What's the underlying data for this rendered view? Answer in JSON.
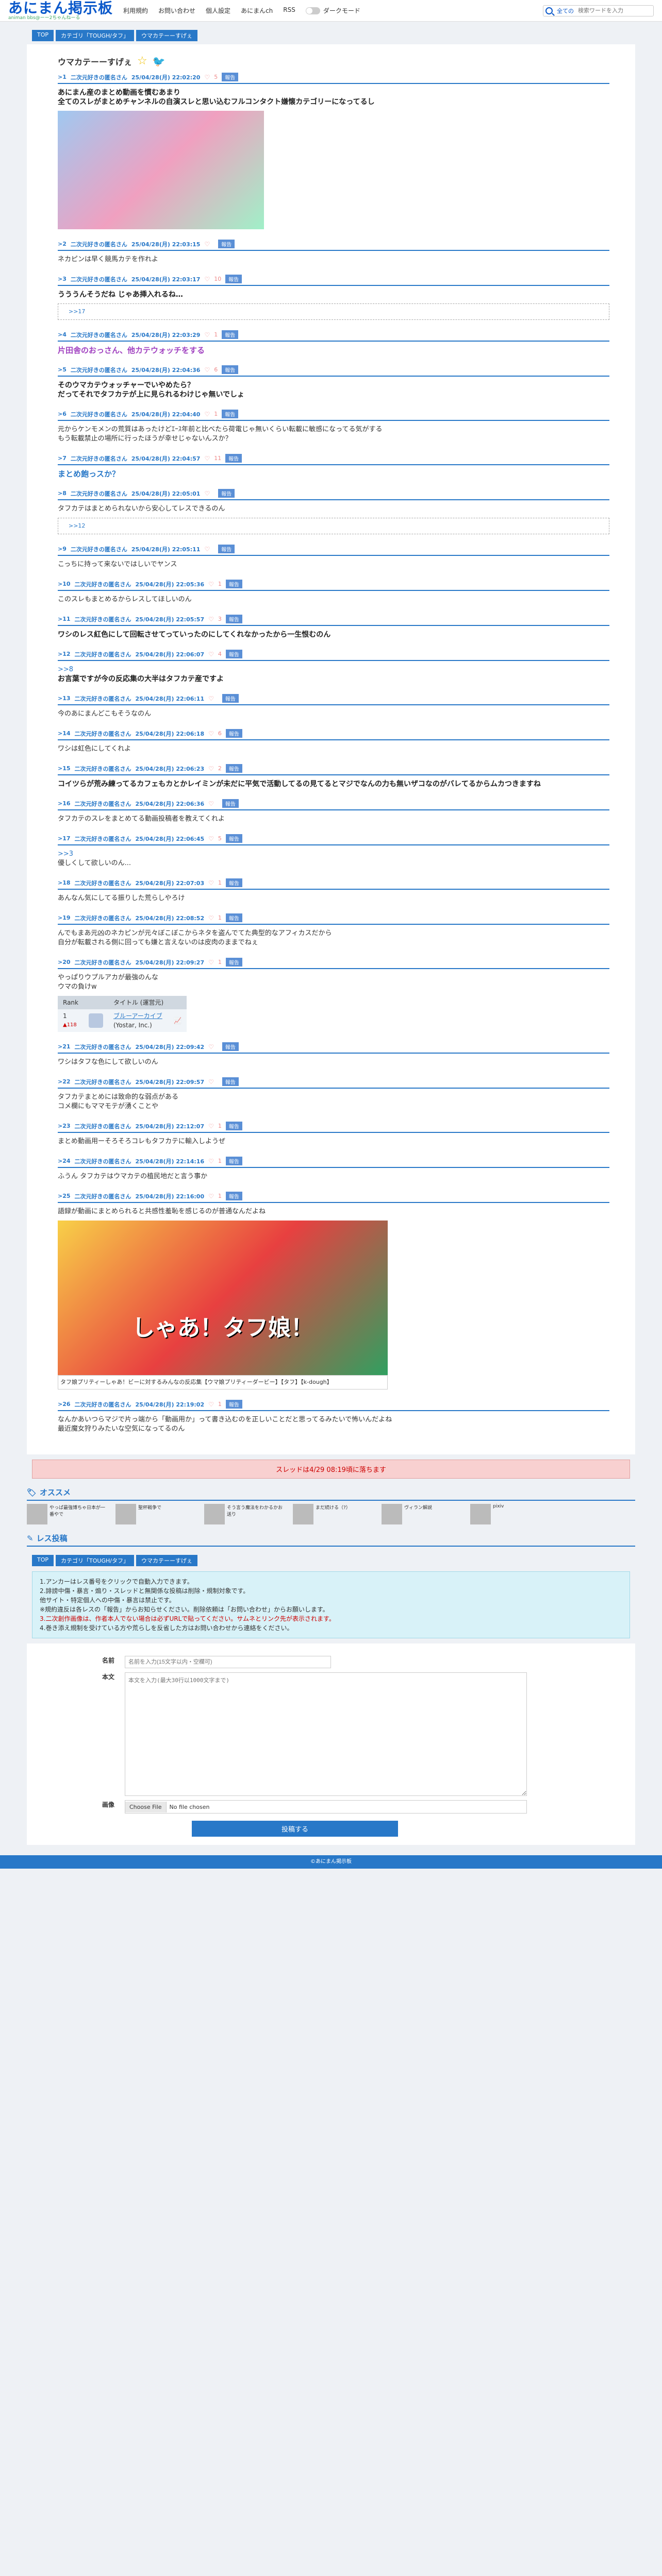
{
  "header": {
    "logo": "あにまん掲示板",
    "logo_sub": "animan bbs@ーー2ちゃんねーる",
    "nav": [
      "利用規約",
      "お問い合わせ",
      "個人設定",
      "あにまんch",
      "RSS"
    ],
    "dark_mode": "ダークモード",
    "search_select": "全ての",
    "search_placeholder": "検索ワードを入力"
  },
  "breadcrumb": [
    "TOP",
    "カテゴリ「TOUGH/タフ」",
    "ウマカテーーすげぇ"
  ],
  "thread_title": "ウマカテーーすげぇ",
  "posts": [
    {
      "num": ">1",
      "name": "二次元好きの匿名さん",
      "date": "25/04/28(月) 22:02:20",
      "likes": "5",
      "report": "報告",
      "body": [
        "あにまん産のまとめ動画を慣むあまり",
        "全てのスレがまとめチャンネルの自演スレと思い込むフルコンタクト嫌懐カテゴリーになってるし"
      ]
    },
    {
      "num": ">2",
      "name": "二次元好きの匿名さん",
      "date": "25/04/28(月) 22:03:15",
      "likes": "",
      "report": "報告",
      "body": [
        "ネカピンは早く競馬カテを作れよ"
      ]
    },
    {
      "num": ">3",
      "name": "二次元好きの匿名さん",
      "date": "25/04/28(月) 22:03:17",
      "likes": "10",
      "report": "報告",
      "body": [
        "うううんそうだね じゃあ挿入れるね…"
      ],
      "ref": ">>17"
    },
    {
      "num": ">4",
      "name": "二次元好きの匿名さん",
      "date": "25/04/28(月) 22:03:29",
      "likes": "1",
      "report": "報告",
      "body": [
        "片田舎のおっさん、他カテウォッチをする"
      ]
    },
    {
      "num": ">5",
      "name": "二次元好きの匿名さん",
      "date": "25/04/28(月) 22:04:36",
      "likes": "6",
      "report": "報告",
      "body": [
        "そのウマカテウォッチャーでいやめたら？",
        "だってそれでタフカテが上に見られるわけじゃ無いでしょ"
      ]
    },
    {
      "num": ">6",
      "name": "二次元好きの匿名さん",
      "date": "25/04/28(月) 22:04:40",
      "likes": "1",
      "report": "報告",
      "body": [
        "元からケンモメンの荒質はあったけどｴｰｽ年前と比べたら荷電じゃ無いくらい転載に敏感になってる気がする",
        "もう転載禁止の場所に行ったほうが幸せじゃないんスか？"
      ]
    },
    {
      "num": ">7",
      "name": "二次元好きの匿名さん",
      "date": "25/04/28(月) 22:04:57",
      "likes": "11",
      "report": "報告",
      "body": [
        "まとめ飽っスか？"
      ]
    },
    {
      "num": ">8",
      "name": "二次元好きの匿名さん",
      "date": "25/04/28(月) 22:05:01",
      "likes": "",
      "report": "報告",
      "body": [
        "タフカテはまとめられないから安心してレスできるのん"
      ],
      "ref": ">>12"
    },
    {
      "num": ">9",
      "name": "二次元好きの匿名さん",
      "date": "25/04/28(月) 22:05:11",
      "likes": "",
      "report": "報告",
      "body": [
        "こっちに持って来ないではしいでヤンス"
      ]
    },
    {
      "num": ">10",
      "name": "二次元好きの匿名さん",
      "date": "25/04/28(月) 22:05:36",
      "likes": "1",
      "report": "報告",
      "body": [
        "このスレもまとめるからレスしてほしいのん"
      ]
    },
    {
      "num": ">11",
      "name": "二次元好きの匿名さん",
      "date": "25/04/28(月) 22:05:57",
      "likes": "3",
      "report": "報告",
      "body": [
        "ワシのレス紅色にして回転させてっていったのにしてくれなかったから一生恨むのん"
      ]
    },
    {
      "num": ">12",
      "name": "二次元好きの匿名さん",
      "date": "25/04/28(月) 22:06:07",
      "likes": "4",
      "report": "報告",
      "anc": ">>8",
      "body": [
        "お言葉ですが今の反応集の大半はタフカテ産ですよ"
      ]
    },
    {
      "num": ">13",
      "name": "二次元好きの匿名さん",
      "date": "25/04/28(月) 22:06:11",
      "likes": "",
      "report": "報告",
      "body": [
        "今のあにまんどこもそうなのん"
      ]
    },
    {
      "num": ">14",
      "name": "二次元好きの匿名さん",
      "date": "25/04/28(月) 22:06:18",
      "likes": "6",
      "report": "報告",
      "body": [
        "ワシは虹色にしてくれよ"
      ]
    },
    {
      "num": ">15",
      "name": "二次元好きの匿名さん",
      "date": "25/04/28(月) 22:06:23",
      "likes": "2",
      "report": "報告",
      "body": [
        "コイツらが荒み練ってるカフェもカとかレイミンが未だに平気で活動してるの見てるとマジでなんの力も無いザコなのがバレてるからムカつきますね"
      ]
    },
    {
      "num": ">16",
      "name": "二次元好きの匿名さん",
      "date": "25/04/28(月) 22:06:36",
      "likes": "",
      "report": "報告",
      "body": [
        "タフカテのスレをまとめてる動画投稿者を教えてくれよ"
      ]
    },
    {
      "num": ">17",
      "name": "二次元好きの匿名さん",
      "date": "25/04/28(月) 22:06:45",
      "likes": "5",
      "report": "報告",
      "anc": ">>3",
      "body": [
        "優しくして欲しいのん..."
      ]
    },
    {
      "num": ">18",
      "name": "二次元好きの匿名さん",
      "date": "25/04/28(月) 22:07:03",
      "likes": "1",
      "report": "報告",
      "body": [
        "あんなん気にしてる振りした荒らしやろけ"
      ]
    },
    {
      "num": ">19",
      "name": "二次元好きの匿名さん",
      "date": "25/04/28(月) 22:08:52",
      "likes": "1",
      "report": "報告",
      "body": [
        "んでもまあ元凶のネカピンが元々ぼこぼこからネタを盗んでてた典型的なアフィカスだから",
        "自分が転載される側に回っても嫌と言えないのは皮肉のままでねぇ"
      ]
    },
    {
      "num": ">20",
      "name": "二次元好きの匿名さん",
      "date": "25/04/28(月) 22:09:27",
      "likes": "1",
      "report": "報告",
      "body": [
        "やっぱりウプルアカが最強のんな",
        "ウマの負けw"
      ],
      "table": {
        "headers": [
          "Rank",
          "",
          "タイトル (運営元)",
          ""
        ],
        "rank": "1",
        "change": "▲118",
        "title": "ブルーアーカイブ",
        "pub": "(Yostar, Inc.)"
      }
    },
    {
      "num": ">21",
      "name": "二次元好きの匿名さん",
      "date": "25/04/28(月) 22:09:42",
      "likes": "",
      "report": "報告",
      "body": [
        "ワシはタフな色にして欲しいのん"
      ]
    },
    {
      "num": ">22",
      "name": "二次元好きの匿名さん",
      "date": "25/04/28(月) 22:09:57",
      "likes": "",
      "report": "報告",
      "body": [
        "タフカテまとめには致命的な弱点がある",
        "コメ欄にもママモテが湧くことや"
      ]
    },
    {
      "num": ">23",
      "name": "二次元好きの匿名さん",
      "date": "25/04/28(月) 22:12:07",
      "likes": "1",
      "report": "報告",
      "body": [
        "まとめ動画用ーそろそろコレもタフカテに輸入しようぜ"
      ]
    },
    {
      "num": ">24",
      "name": "二次元好きの匿名さん",
      "date": "25/04/28(月) 22:14:16",
      "likes": "1",
      "report": "報告",
      "body": [
        "ふうん タフカテはウマカテの植民地だと言う事か"
      ]
    },
    {
      "num": ">25",
      "name": "二次元好きの匿名さん",
      "date": "25/04/28(月) 22:16:00",
      "likes": "1",
      "report": "報告",
      "body": [
        "語録が動画にまとめられると共感性羞恥を感じるのが普通なんだよね"
      ],
      "image_caption": "タフ娘プリティーしゃあ！ビーに対するみんなの反応集【ウマ娘プリティーダービー】【タフ】【k-dough】",
      "image_text": "しゃあ！タフ娘！"
    },
    {
      "num": ">26",
      "name": "二次元好きの匿名さん",
      "date": "25/04/28(月) 22:19:02",
      "likes": "1",
      "report": "報告",
      "body": [
        "なんかあいつらマジで片っ端から「動画用か」って書き込むのを正しいことだと思ってるみたいで怖いんだよね",
        "最近魔女狩りみたいな空気になってるのん"
      ]
    }
  ],
  "banner": "スレッドは4/29 08:19頃に落ちます",
  "recommend": {
    "title": "オススメ",
    "items": [
      "やっぱ最強博ちゃ日本が一番やで",
      "聖杯戦争で",
      "そう言う魔法をわかるかお送り",
      "まだ続ける（?）",
      "ヴィラン解説",
      "pixiv"
    ]
  },
  "reply": {
    "title": "レス投稿",
    "notes": [
      "1.アンカーはレス番号をクリックで自動入力できます。",
      "2.誹謗中傷・暴言・煽り・スレッドと無関係な投稿は削除・規制対象です。",
      "他サイト・特定個人への中傷・暴言は禁止です。",
      "※規約違反は各レスの「報告」からお知らせください。削除依頼は「お問い合わせ」からお願いします。",
      "3.二次創作画像は、作者本人でない場合は必ずURLで貼ってください。サムネとリンク先が表示されます。",
      "4.巻き添え規制を受けている方や荒らしを反省した方はお問い合わせから連絡をください。"
    ],
    "name_label": "名前",
    "name_placeholder": "名前を入力(15文字以内・空欄可)",
    "body_label": "本文",
    "body_placeholder": "本文を入力(最大30行以1000文字まで)",
    "image_label": "画像",
    "file_btn": "Choose File",
    "file_none": "No file chosen",
    "submit": "投稿する"
  },
  "footer": "©あにまん掲示板"
}
